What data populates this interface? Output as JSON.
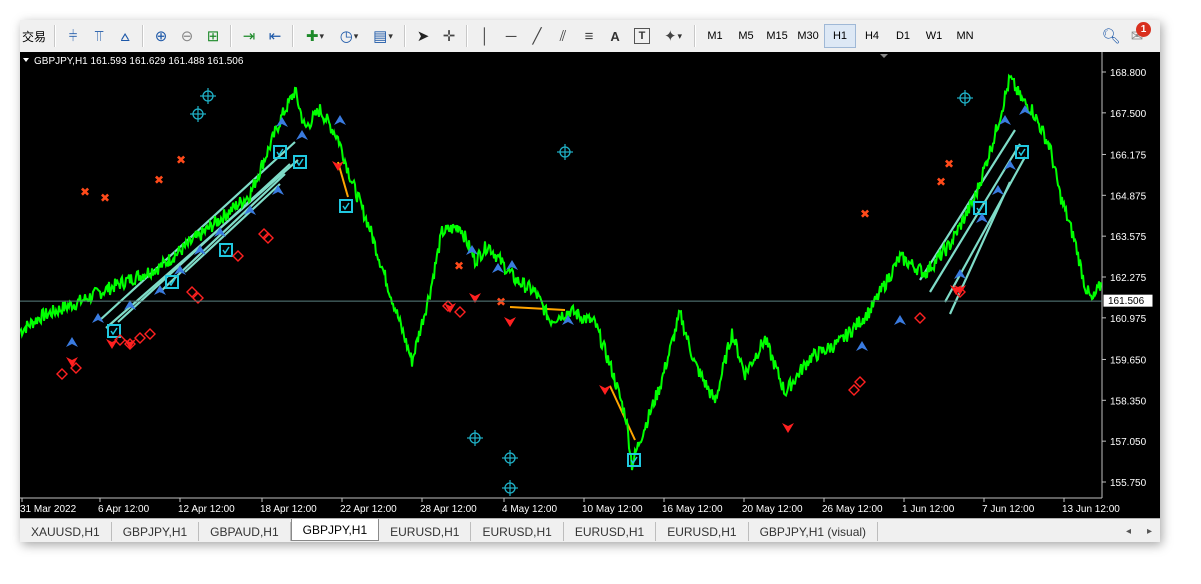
{
  "toolbar": {
    "trade_label": "交易",
    "timeframes": [
      {
        "label": "M1",
        "active": false
      },
      {
        "label": "M5",
        "active": false
      },
      {
        "label": "M15",
        "active": false
      },
      {
        "label": "M30",
        "active": false
      },
      {
        "label": "H1",
        "active": true
      },
      {
        "label": "H4",
        "active": false
      },
      {
        "label": "D1",
        "active": false
      },
      {
        "label": "W1",
        "active": false
      },
      {
        "label": "MN",
        "active": false
      }
    ],
    "text_tool_label": "A",
    "textbox_tool_label": "T",
    "notification_count": "1"
  },
  "chart": {
    "symbol_header": "GBPJPY,H1  161.593 161.629 161.488 161.506",
    "current_price": 161.506,
    "current_price_label": "161.506",
    "price_ticks": [
      "168.800",
      "167.500",
      "166.175",
      "164.875",
      "163.575",
      "162.275",
      "160.975",
      "159.650",
      "158.350",
      "157.050",
      "155.750"
    ],
    "date_ticks": [
      "31 Mar 2022",
      "6 Apr 12:00",
      "12 Apr 12:00",
      "18 Apr 12:00",
      "22 Apr 12:00",
      "28 Apr 12:00",
      "4 May 12:00",
      "10 May 12:00",
      "16 May 12:00",
      "20 May 12:00",
      "26 May 12:00",
      "1 Jun 12:00",
      "7 Jun 12:00",
      "13 Jun 12:00"
    ],
    "colors": {
      "background": "#000000",
      "price_line": "#00ff00",
      "trendline": "#7fdcc8",
      "buy_arrow": "#3a7be0",
      "sell_arrow": "#ff2020",
      "marker_x": "#ff4a1a",
      "target": "#20b2c8",
      "box": "#20c8e0",
      "connector": "#ffa500"
    }
  },
  "tabs": [
    {
      "label": "XAUUSD,H1",
      "active": false
    },
    {
      "label": "GBPJPY,H1",
      "active": false
    },
    {
      "label": "GBPAUD,H1",
      "active": false
    },
    {
      "label": "GBPJPY,H1",
      "active": true
    },
    {
      "label": "EURUSD,H1",
      "active": false
    },
    {
      "label": "EURUSD,H1",
      "active": false
    },
    {
      "label": "EURUSD,H1",
      "active": false
    },
    {
      "label": "EURUSD,H1",
      "active": false
    },
    {
      "label": "GBPJPY,H1 (visual)",
      "active": false
    }
  ]
}
